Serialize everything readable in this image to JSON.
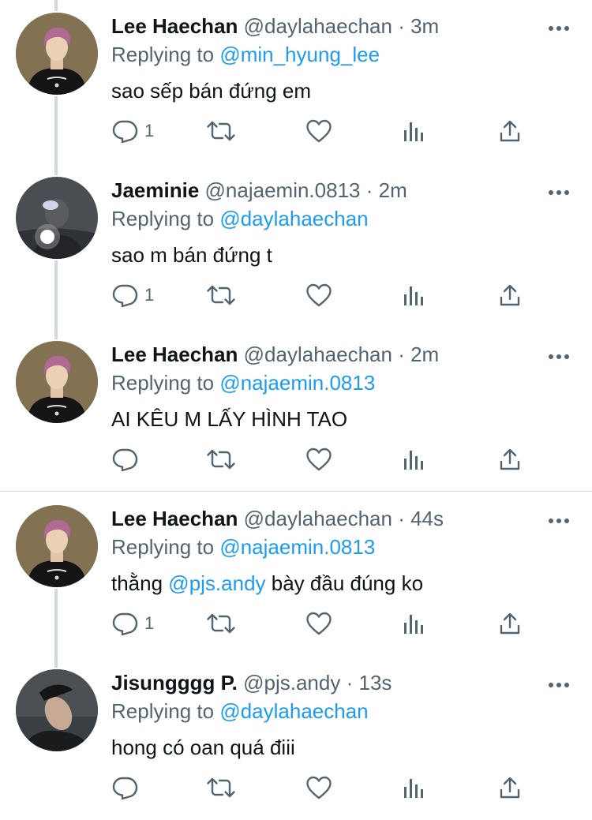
{
  "tweets": [
    {
      "name": "Lee Haechan",
      "handle": "@daylahaechan",
      "dot": "·",
      "time": "3m",
      "replying_prefix": "Replying to",
      "replying_to": "@min_hyung_lee",
      "body_parts": [
        "sao sếp bán đứng em"
      ],
      "reply_count": "1",
      "avatar": "haechan"
    },
    {
      "name": "Jaeminie",
      "handle": "@najaemin.0813",
      "dot": "·",
      "time": "2m",
      "replying_prefix": "Replying to",
      "replying_to": "@daylahaechan",
      "body_parts": [
        "sao m bán đứng t"
      ],
      "reply_count": "1",
      "avatar": "jaemin"
    },
    {
      "name": "Lee Haechan",
      "handle": "@daylahaechan",
      "dot": "·",
      "time": "2m",
      "replying_prefix": "Replying to",
      "replying_to": "@najaemin.0813",
      "body_parts": [
        "AI KÊU M LẤY HÌNH TAO"
      ],
      "reply_count": "",
      "avatar": "haechan"
    },
    {
      "name": "Lee Haechan",
      "handle": "@daylahaechan",
      "dot": "·",
      "time": "44s",
      "replying_prefix": "Replying to",
      "replying_to": "@najaemin.0813",
      "body_parts": [
        "thằng ",
        "@pjs.andy",
        " bày đầu đúng ko"
      ],
      "reply_count": "1",
      "avatar": "haechan"
    },
    {
      "name": "Jisungggg P.",
      "handle": "@pjs.andy",
      "dot": "·",
      "time": "13s",
      "replying_prefix": "Replying to",
      "replying_to": "@daylahaechan",
      "body_parts": [
        "hong có oan quá điii"
      ],
      "reply_count": "",
      "avatar": "jisung"
    }
  ],
  "icons": {
    "reply": "reply-icon",
    "retweet": "retweet-icon",
    "like": "heart-icon",
    "views": "views-icon",
    "share": "share-icon",
    "more": "more-icon"
  },
  "colors": {
    "link": "#1d9bf0",
    "secondary_text": "#536471",
    "icon": "#536471",
    "divider": "#cfd9de"
  }
}
